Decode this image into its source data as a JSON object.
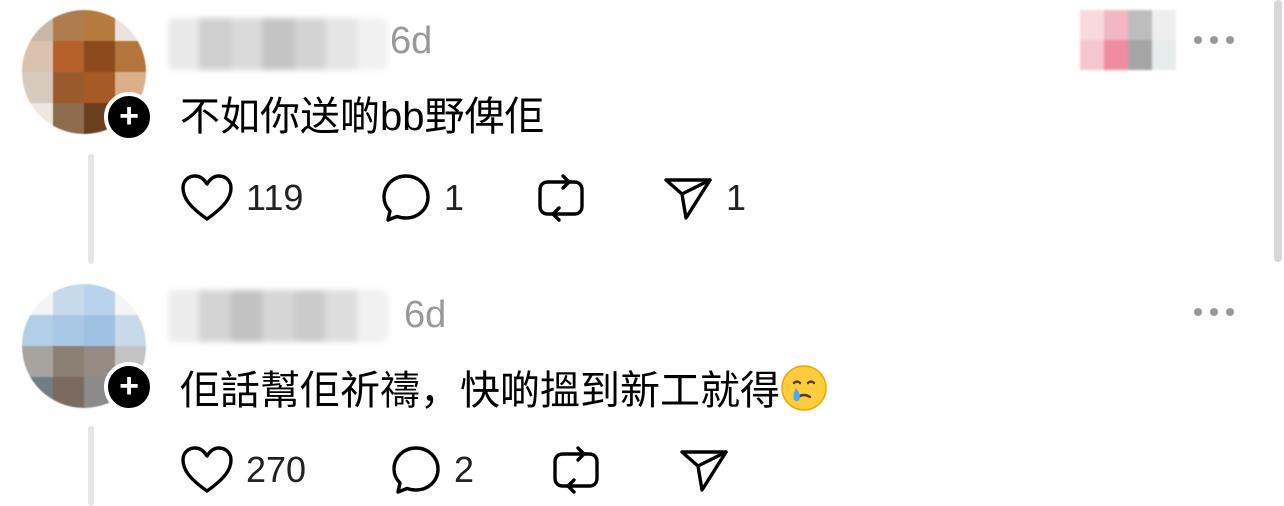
{
  "posts": [
    {
      "time": "6d",
      "text": "不如你送啲bb野俾佢",
      "likes": "119",
      "replies": "1",
      "reposts": "",
      "shares": "1"
    },
    {
      "time": "6d",
      "text": "佢話幫佢祈禱，快啲搵到新工就得",
      "emoji": "face-holding-back-tears",
      "likes": "270",
      "replies": "2",
      "reposts": "",
      "shares": ""
    }
  ],
  "icons": {
    "like": "heart-icon",
    "reply": "comment-icon",
    "repost": "repost-icon",
    "share": "send-icon",
    "more": "more-icon",
    "follow": "plus-icon"
  },
  "colors": {
    "text": "#000000",
    "muted": "#999999",
    "icon": "#000000",
    "thread_line": "#e6e6e6"
  }
}
